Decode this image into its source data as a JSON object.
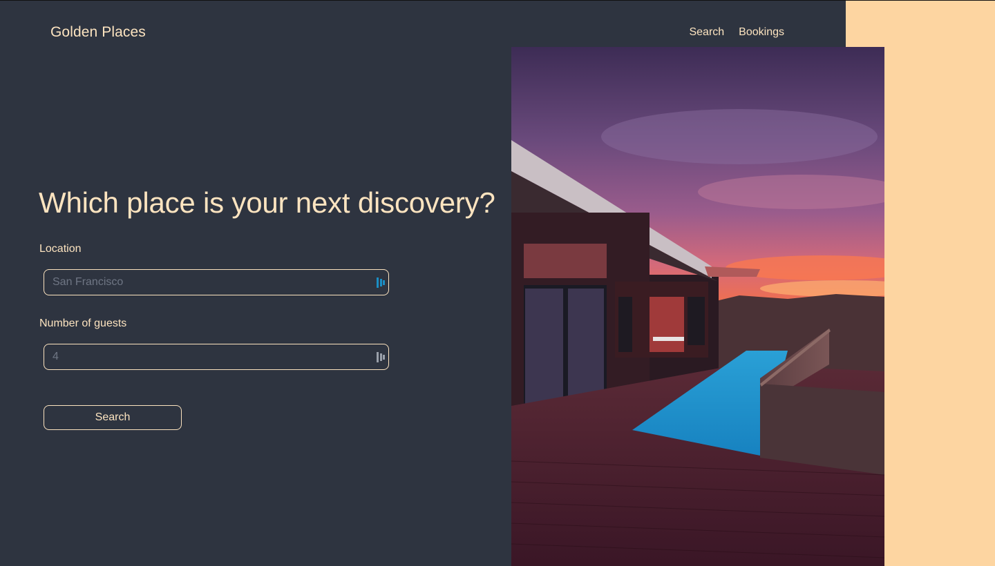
{
  "brand": {
    "name": "Golden Places"
  },
  "nav": {
    "items": [
      {
        "label": "Search"
      },
      {
        "label": "Bookings"
      }
    ]
  },
  "hero": {
    "headline": "Which place is your next discovery?"
  },
  "form": {
    "location": {
      "label": "Location",
      "placeholder": "San Francisco",
      "value": "",
      "icon": "autofill-contact-icon"
    },
    "guests": {
      "label": "Number of guests",
      "placeholder": "4",
      "value": "",
      "icon": "autofill-contact-icon"
    },
    "submit_label": "Search"
  },
  "colors": {
    "background": "#2e3440",
    "accent": "#fde4c0",
    "side_panel": "#fdd5a1"
  },
  "image": {
    "subject": "modern-house-with-pool-at-sunset"
  }
}
